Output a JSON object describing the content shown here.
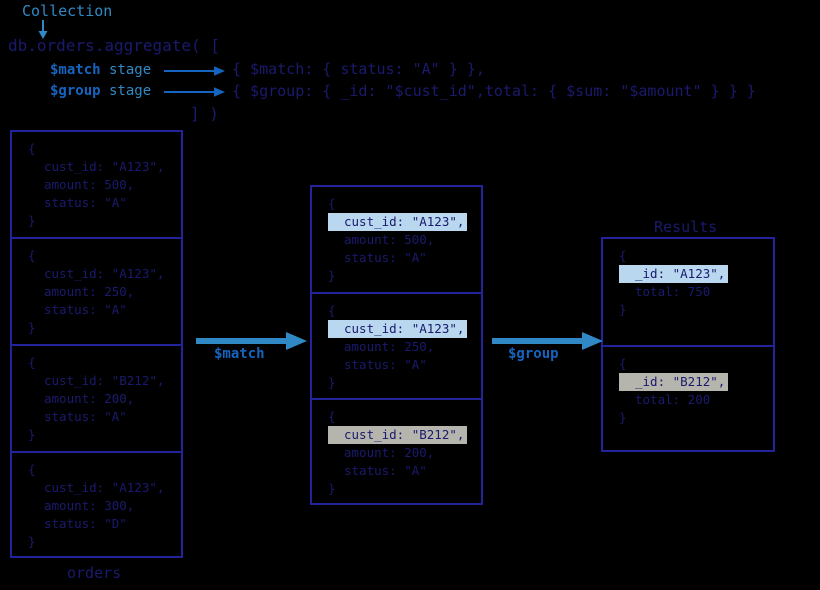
{
  "header": {
    "collection_label": "Collection",
    "query_line": "db.orders.aggregate( [",
    "query_close": "] )",
    "stages": [
      {
        "sigil": "$match",
        "word": " stage"
      },
      {
        "sigil": "$group",
        "word": " stage"
      }
    ],
    "pipeline_lines": [
      "{ $match: { status: \"A\" } },",
      "{ $group: { _id: \"$cust_id\",total: { $sum: \"$amount\" } } }"
    ]
  },
  "columns": {
    "orders": {
      "caption": "orders",
      "docs": [
        {
          "lines": [
            {
              "text": "{",
              "indent": false,
              "highlight": "none"
            },
            {
              "text": "cust_id: \"A123\",",
              "indent": true,
              "highlight": "none"
            },
            {
              "text": "amount: 500,",
              "indent": true,
              "highlight": "none"
            },
            {
              "text": "status: \"A\"",
              "indent": true,
              "highlight": "none"
            },
            {
              "text": "}",
              "indent": false,
              "highlight": "none"
            }
          ]
        },
        {
          "lines": [
            {
              "text": "{",
              "indent": false,
              "highlight": "none"
            },
            {
              "text": "cust_id: \"A123\",",
              "indent": true,
              "highlight": "none"
            },
            {
              "text": "amount: 250,",
              "indent": true,
              "highlight": "none"
            },
            {
              "text": "status: \"A\"",
              "indent": true,
              "highlight": "none"
            },
            {
              "text": "}",
              "indent": false,
              "highlight": "none"
            }
          ]
        },
        {
          "lines": [
            {
              "text": "{",
              "indent": false,
              "highlight": "none"
            },
            {
              "text": "cust_id: \"B212\",",
              "indent": true,
              "highlight": "none"
            },
            {
              "text": "amount: 200,",
              "indent": true,
              "highlight": "none"
            },
            {
              "text": "status: \"A\"",
              "indent": true,
              "highlight": "none"
            },
            {
              "text": "}",
              "indent": false,
              "highlight": "none"
            }
          ]
        },
        {
          "lines": [
            {
              "text": "{",
              "indent": false,
              "highlight": "none"
            },
            {
              "text": "cust_id: \"A123\",",
              "indent": true,
              "highlight": "none"
            },
            {
              "text": "amount: 300,",
              "indent": true,
              "highlight": "none"
            },
            {
              "text": "status: \"D\"",
              "indent": true,
              "highlight": "none"
            },
            {
              "text": "}",
              "indent": false,
              "highlight": "none"
            }
          ]
        }
      ]
    },
    "matched": {
      "caption": "",
      "docs": [
        {
          "lines": [
            {
              "text": "{",
              "indent": false,
              "highlight": "none"
            },
            {
              "text": "cust_id: \"A123\",",
              "indent": true,
              "highlight": "blue"
            },
            {
              "text": "amount: 500,",
              "indent": true,
              "highlight": "none"
            },
            {
              "text": "status: \"A\"",
              "indent": true,
              "highlight": "none"
            },
            {
              "text": "}",
              "indent": false,
              "highlight": "none"
            }
          ]
        },
        {
          "lines": [
            {
              "text": "{",
              "indent": false,
              "highlight": "none"
            },
            {
              "text": "cust_id: \"A123\",",
              "indent": true,
              "highlight": "blue"
            },
            {
              "text": "amount: 250,",
              "indent": true,
              "highlight": "none"
            },
            {
              "text": "status: \"A\"",
              "indent": true,
              "highlight": "none"
            },
            {
              "text": "}",
              "indent": false,
              "highlight": "none"
            }
          ]
        },
        {
          "lines": [
            {
              "text": "{",
              "indent": false,
              "highlight": "none"
            },
            {
              "text": "cust_id: \"B212\",",
              "indent": true,
              "highlight": "gray"
            },
            {
              "text": "amount: 200,",
              "indent": true,
              "highlight": "none"
            },
            {
              "text": "status: \"A\"",
              "indent": true,
              "highlight": "none"
            },
            {
              "text": "}",
              "indent": false,
              "highlight": "none"
            }
          ]
        }
      ]
    },
    "results": {
      "caption": "Results",
      "docs": [
        {
          "lines": [
            {
              "text": "{",
              "indent": false,
              "highlight": "none"
            },
            {
              "text": "_id: \"A123\",",
              "indent": true,
              "highlight": "blue"
            },
            {
              "text": "total: 750",
              "indent": true,
              "highlight": "none"
            },
            {
              "text": "}",
              "indent": false,
              "highlight": "none"
            }
          ]
        },
        {
          "lines": [
            {
              "text": "{",
              "indent": false,
              "highlight": "none"
            },
            {
              "text": "_id: \"B212\",",
              "indent": true,
              "highlight": "gray"
            },
            {
              "text": "total: 200",
              "indent": true,
              "highlight": "none"
            },
            {
              "text": "}",
              "indent": false,
              "highlight": "none"
            }
          ]
        }
      ]
    }
  },
  "arrows": {
    "match_label": "$match",
    "group_label": "$group"
  },
  "colors": {
    "background": "#000000",
    "navy_text": "#1a1a6e",
    "border": "#23239c",
    "accent_blue": "#3089c4",
    "sigil_blue": "#1565c0",
    "highlight_blue": "#b9d7ee",
    "highlight_gray": "#b5b5ad"
  }
}
